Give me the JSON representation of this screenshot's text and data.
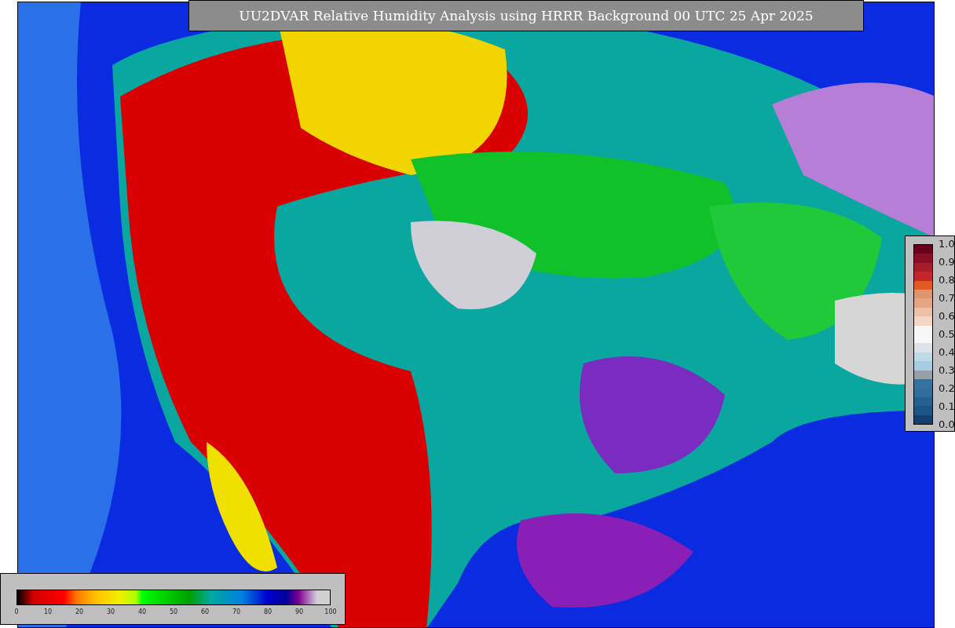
{
  "title": "UU2DVAR Relative Humidity Analysis using HRRR Background 00 UTC 25 Apr 2025",
  "humidity_colorbar": {
    "ticks": [
      "0",
      "10",
      "20",
      "30",
      "40",
      "50",
      "60",
      "70",
      "80",
      "90",
      "100"
    ]
  },
  "legend_colorbar": {
    "ticks": [
      "1.0",
      "0.9",
      "0.8",
      "0.7",
      "0.6",
      "0.5",
      "0.4",
      "0.3",
      "0.2",
      "0.1",
      "0.0"
    ]
  }
}
